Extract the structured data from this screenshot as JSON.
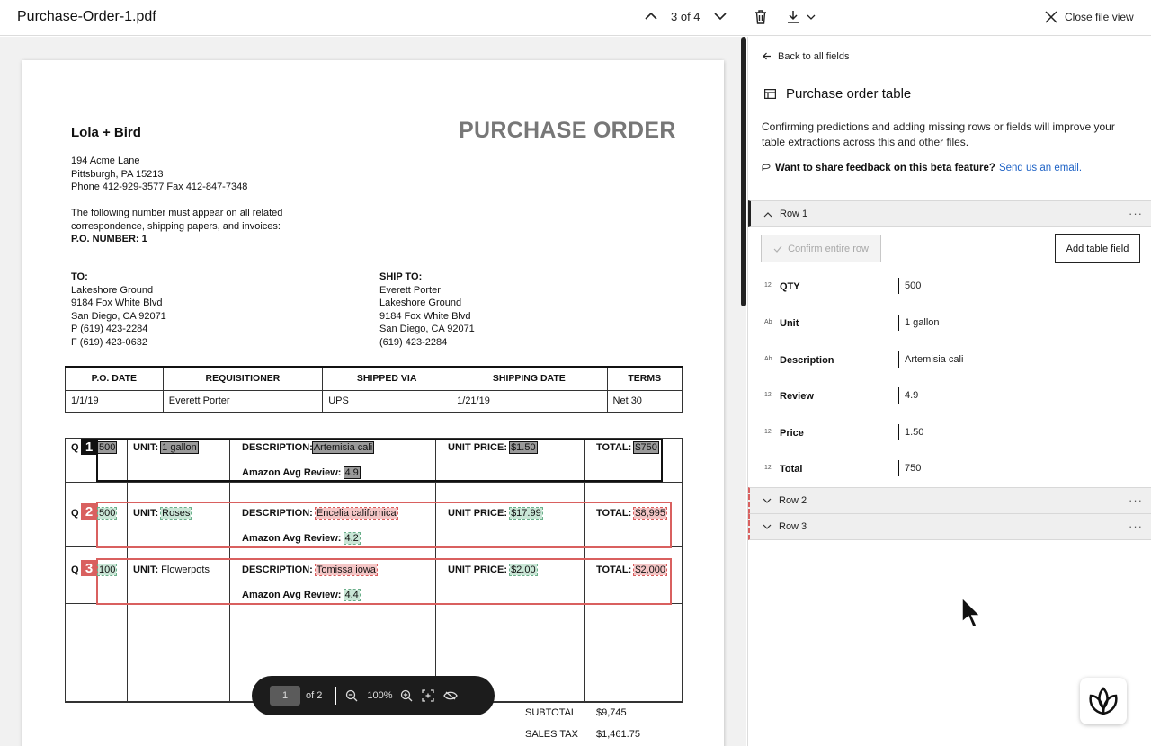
{
  "header": {
    "file_name": "Purchase-Order-1.pdf",
    "pager_text": "3 of 4",
    "close_label": "Close file view"
  },
  "document": {
    "company": "Lola + Bird",
    "title": "PURCHASE ORDER",
    "address_lines": [
      "194 Acme Lane",
      "Pittsburgh, PA 15213",
      "Phone 412-929-3577  Fax 412-847-7348"
    ],
    "notice_lines": [
      "The following number must appear on all related",
      "correspondence, shipping papers, and invoices:"
    ],
    "po_number": "P.O. NUMBER: 1",
    "to_label": "TO:",
    "to_lines": [
      "Lakeshore Ground",
      "9184 Fox White Blvd",
      "San Diego, CA 92071",
      "P (619) 423-2284",
      "F (619) 423-0632"
    ],
    "ship_label": "SHIP TO:",
    "ship_lines": [
      "Everett Porter",
      "Lakeshore Ground",
      "9184 Fox White Blvd",
      "San Diego, CA 92071",
      "(619) 423-2284"
    ],
    "info_headers": [
      "P.O. DATE",
      "REQUISITIONER",
      "SHIPPED VIA",
      "SHIPPING DATE",
      "TERMS"
    ],
    "info_values": [
      "1/1/19",
      "Everett Porter",
      "UPS",
      "1/21/19",
      "Net 30"
    ],
    "labels": {
      "unit": "UNIT:",
      "description": "DESCRIPTION:",
      "unit_price": "UNIT PRICE:",
      "total": "TOTAL:",
      "review": "Amazon Avg Review:",
      "qty_prefix": "Q"
    },
    "items": [
      {
        "badge": "1",
        "qty": "500",
        "unit": "1 gallon",
        "description": "Artemisia cali",
        "unit_price": "$1.50",
        "total": "$750",
        "review": "4.9"
      },
      {
        "badge": "2",
        "qty": "500",
        "unit": "Roses",
        "description": "Encelia californica",
        "unit_price": "$17.99",
        "total": "$8,995",
        "review": "4.2"
      },
      {
        "badge": "3",
        "qty": "100",
        "unit": "Flowerpots",
        "description": "Tomissa iowa",
        "unit_price": "$2.00",
        "total": "$2,000",
        "review": "4.4"
      }
    ],
    "subtotal_label": "SUBTOTAL",
    "subtotal_value": "$9,745",
    "tax_label": "SALES TAX",
    "tax_value": "$1,461.75"
  },
  "zoombar": {
    "page": "1",
    "of_pages": "of 2",
    "zoom": "100%"
  },
  "panel": {
    "back_label": "Back to all fields",
    "title": "Purchase order table",
    "description": "Confirming predictions and adding missing rows or fields will improve your table extractions across this and other files.",
    "feedback_question": "Want to share feedback on this beta feature?",
    "feedback_link": "Send us an email.",
    "rows": [
      "Row 1",
      "Row 2",
      "Row 3"
    ],
    "confirm_label": "Confirm entire row",
    "add_field_label": "Add table field",
    "fields": [
      {
        "type": "12",
        "name": "QTY",
        "value": "500"
      },
      {
        "type": "Ab",
        "name": "Unit",
        "value": "1 gallon"
      },
      {
        "type": "Ab",
        "name": "Description",
        "value": "Artemisia cali"
      },
      {
        "type": "12",
        "name": "Review",
        "value": "4.9"
      },
      {
        "type": "12",
        "name": "Price",
        "value": "1.50"
      },
      {
        "type": "12",
        "name": "Total",
        "value": "750"
      }
    ],
    "more_glyph": "···"
  },
  "colors": {
    "accent_link": "#1f63c6",
    "row_unconfirmed": "#d9605f",
    "row_selected": "#111111"
  },
  "icons": [
    "chevron-up-icon",
    "chevron-down-icon",
    "trash-icon",
    "download-icon",
    "close-icon",
    "arrow-left-icon",
    "table-icon",
    "chat-icon",
    "zoom-out-icon",
    "zoom-in-icon",
    "fit-icon",
    "eye-off-icon",
    "assistant-logo-icon",
    "cursor-icon",
    "check-icon"
  ]
}
